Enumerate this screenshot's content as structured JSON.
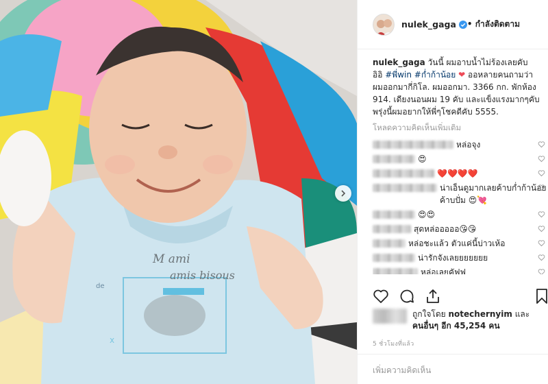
{
  "post": {
    "username": "nulek_gaga",
    "follow_status": "• กำลังติดตาม",
    "caption_username": "nulek_gaga",
    "caption_text_1": " วันนี้ ผมอาบน้ำไม่ร้องเลยคับ อิอิ ",
    "hashtag_1": "#พี่win",
    "hashtag_2": "#ก่ำก้าน้อย",
    "caption_text_2": " ออหลายคนถามว่าผมออกมากี่กิโล. ผมออกมา. 3366 กก. พักห้อง 914. เดียงนอนผม 19 คับ และแข็งแรงมากๆคับ พรุ่งนี้ผมอยากให้พี่ๆโชคดีคับ 5555.",
    "load_more": "โหลดความคิดเห็นเพิ่มเติม",
    "shirt_line_1": "M ami",
    "shirt_line_2": "amis bisous"
  },
  "comments": [
    {
      "text": "หล่อจุง",
      "emoji": ""
    },
    {
      "text": "",
      "emoji": "😍"
    },
    {
      "text": "",
      "emoji": "❤️❤️❤️❤️"
    },
    {
      "text": "น่าเอ็นดูมากเลยค้าบก่ำก้าน้อยค้าบปั่ม",
      "emoji": "😍💘"
    },
    {
      "text": "",
      "emoji": "😍😍"
    },
    {
      "text": "สุดหล่อออออ",
      "emoji": "😘😘"
    },
    {
      "text": "หล่อชะแล้ว ตัวแค่นี้บ่าวเห้อ",
      "emoji": ""
    },
    {
      "text": "น่ารักจังเลยยยยยยย",
      "emoji": ""
    },
    {
      "text": "หล่อเลยคัฟฟ",
      "emoji": ""
    }
  ],
  "likes": {
    "prefix": "ถูกใจโดย ",
    "user": "notechernyim",
    "mid": " และ ",
    "others_label": "คนอื่นๆ อีก 45,254 คน"
  },
  "timestamp": "5 ชั่วโมงที่แล้ว",
  "add_comment_placeholder": "เพิ่มความคิดเห็น",
  "icons": {
    "verified": "verified-badge-icon",
    "heart": "heart-icon",
    "comment": "comment-icon",
    "share": "share-icon",
    "bookmark": "bookmark-icon",
    "next": "chevron-right-icon"
  },
  "colors": {
    "verified_blue": "#3897f0",
    "heart_red": "#ed4956",
    "hashtag_blue": "#003569",
    "muted_gray": "#999999"
  }
}
